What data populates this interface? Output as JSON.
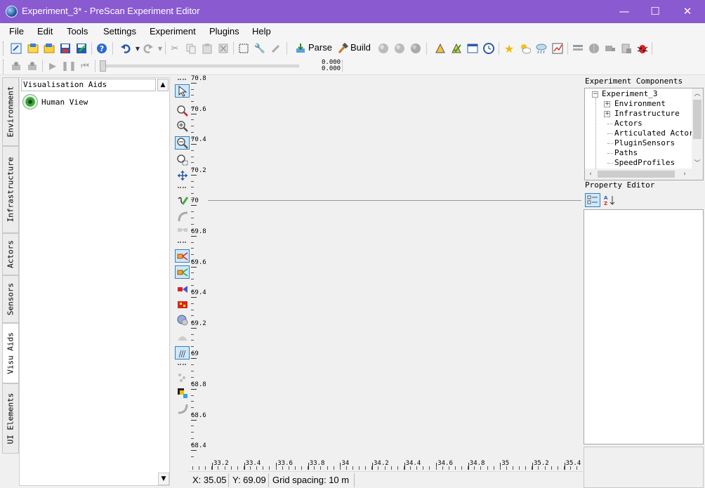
{
  "window": {
    "title": "Experiment_3* - PreScan Experiment Editor",
    "controls": {
      "minimize": "—",
      "maximize": "☐",
      "close": "✕"
    }
  },
  "menu": [
    "File",
    "Edit",
    "Tools",
    "Settings",
    "Experiment",
    "Plugins",
    "Help"
  ],
  "toolbar": {
    "parse_label": "Parse",
    "build_label": "Build",
    "time_top": "0.000",
    "time_bottom": "0.000"
  },
  "left_tabs": [
    "Environment",
    "Infrastructure",
    "Actors",
    "Sensors",
    "Visu Aids",
    "UI Elements"
  ],
  "active_left_tab": "Visu Aids",
  "visualisation_panel": {
    "header": "Visualisation Aids",
    "items": [
      {
        "label": "Human View",
        "icon": "eye-icon"
      }
    ]
  },
  "rulers": {
    "vertical_labels": [
      "70.8",
      "70.6",
      "70.4",
      "70.2",
      "70",
      "69.8",
      "69.6",
      "69.4",
      "69.2",
      "69",
      "68.8",
      "68.6",
      "68.4"
    ],
    "horizontal_labels": [
      "33.2",
      "33.4",
      "33.6",
      "33.8",
      "34",
      "34.2",
      "34.4",
      "34.6",
      "34.8",
      "35",
      "35.2",
      "35.4"
    ]
  },
  "status": {
    "x": "X: 35.05",
    "y": "Y: 69.09",
    "grid": "Grid spacing: 10 m"
  },
  "experiment_components": {
    "title": "Experiment Components",
    "root": "Experiment_3",
    "children": [
      "Environment",
      "Infrastructure",
      "Actors",
      "Articulated Actors",
      "PluginSensors",
      "Paths",
      "SpeedProfiles"
    ]
  },
  "property_editor": {
    "title": "Property Editor",
    "categorized_icon": "categorized-icon",
    "sort_icon": "sort-az-icon"
  },
  "colors": {
    "titlebar": "#8a5ad0",
    "selection": "#cde8ff",
    "selection_border": "#3c7fb1"
  }
}
